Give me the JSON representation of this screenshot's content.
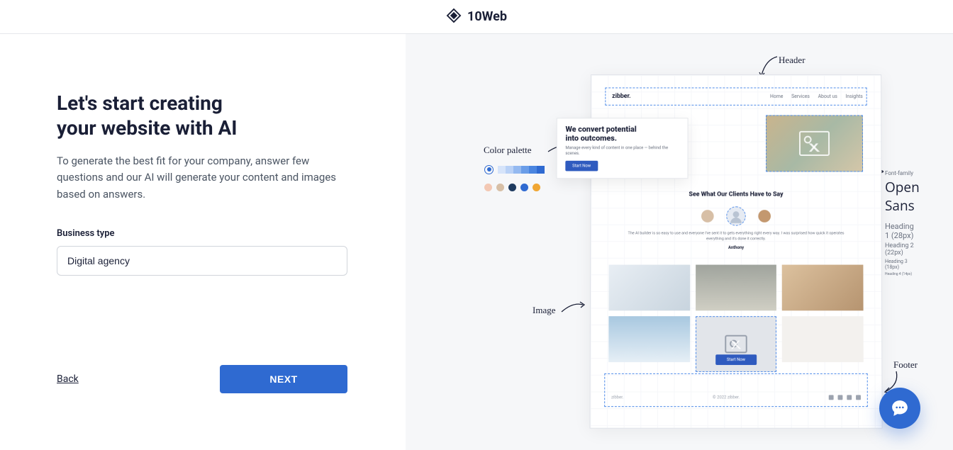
{
  "brand": "10Web",
  "form": {
    "heading_line1": "Let's start creating",
    "heading_line2": "your website with AI",
    "subheading": "To generate the best fit for your company, answer few questions and our AI will generate your content and images based on answers.",
    "business_type_label": "Business type",
    "business_type_value": "Digital agency",
    "back_label": "Back",
    "next_label": "NEXT"
  },
  "preview": {
    "annotations": {
      "header": "Header",
      "color_palette": "Color palette",
      "image": "Image",
      "font_family": "Font-family",
      "footer": "Footer"
    },
    "site": {
      "brand": "zibber.",
      "nav": [
        "Home",
        "Services",
        "About us",
        "Insights"
      ],
      "hero_title_line1": "We convert potential",
      "hero_title_line2": "into outcomes.",
      "hero_sub": "Manage every kind of content in one place — behind the scenes.",
      "hero_button": "Start Now",
      "testimonials_heading": "See What Our Clients Have to Say",
      "testimonial_text": "The AI builder is so easy to use and everyone I've sent it to gets everything right every way. I was surprised how quick it operates everything and it's done it correctly.",
      "testimonial_name": "Anthony",
      "cta_button": "Start Now",
      "footer_brand": "zibber.",
      "copyright": "© 2022 zibber."
    },
    "palette": {
      "gradient": [
        "#d6e4fa",
        "#b9d1f6",
        "#94b9f0",
        "#6a9de8",
        "#4a85e0",
        "#2f6ad1"
      ],
      "dots": [
        "#f3c8b4",
        "#d7bfa6",
        "#1e3a5f",
        "#2f6ad1",
        "#f0a633"
      ]
    },
    "typography": {
      "label": "Font-family",
      "name": "Open Sans",
      "samples": [
        {
          "label": "Heading 1 (28px)",
          "cls": "fs1"
        },
        {
          "label": "Heading 2 (22px)",
          "cls": "fs2"
        },
        {
          "label": "Heading 3 (18px)",
          "cls": "fs3"
        },
        {
          "label": "Heading 4 (14px)",
          "cls": "fs4"
        }
      ]
    }
  }
}
